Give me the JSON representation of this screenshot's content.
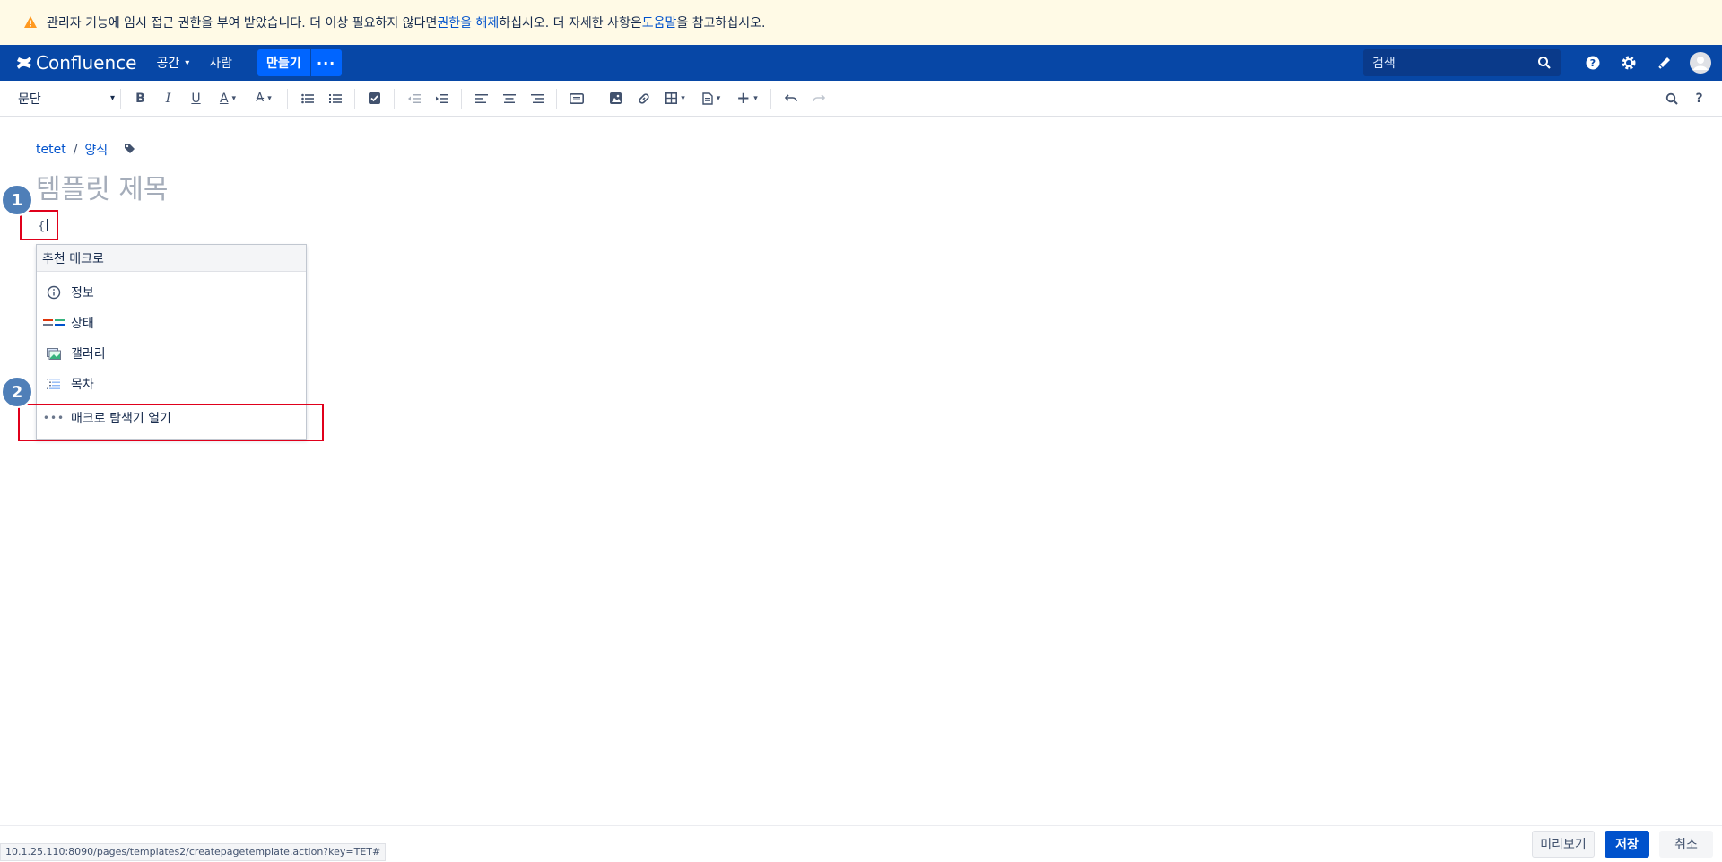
{
  "banner": {
    "text_before": "관리자 기능에 임시 접근 권한을 부여 받았습니다. 더 이상 필요하지 않다면 ",
    "revoke_link": "권한을 해제",
    "text_middle": "하십시오. 더 자세한 사항은 ",
    "help_link": "도움말",
    "text_after": "을 참고하십시오."
  },
  "nav": {
    "logo": "Confluence",
    "spaces": "공간",
    "people": "사람",
    "create": "만들기",
    "more": "···",
    "search_placeholder": "검색"
  },
  "toolbar": {
    "paragraph": "문단"
  },
  "breadcrumb": {
    "space": "tetet",
    "section": "양식"
  },
  "editor": {
    "title_placeholder": "템플릿 제목",
    "typed_text": "{"
  },
  "annotations": {
    "badge1": "1",
    "badge2": "2"
  },
  "macro_menu": {
    "header": "추천 매크로",
    "items": [
      {
        "label": "정보",
        "icon": "info-icon"
      },
      {
        "label": "상태",
        "icon": "status-icon"
      },
      {
        "label": "갤러리",
        "icon": "gallery-icon"
      },
      {
        "label": "목차",
        "icon": "toc-icon"
      }
    ],
    "browser": "매크로 탐색기 열기"
  },
  "footer": {
    "status_url": "10.1.25.110:8090/pages/templates2/createpagetemplate.action?key=TET#",
    "preview": "미리보기",
    "save": "저장",
    "cancel": "취소"
  },
  "colors": {
    "nav_bg": "#0747a6",
    "banner_bg": "#fffae6",
    "accent": "#0052cc",
    "highlight": "#e0001b"
  }
}
